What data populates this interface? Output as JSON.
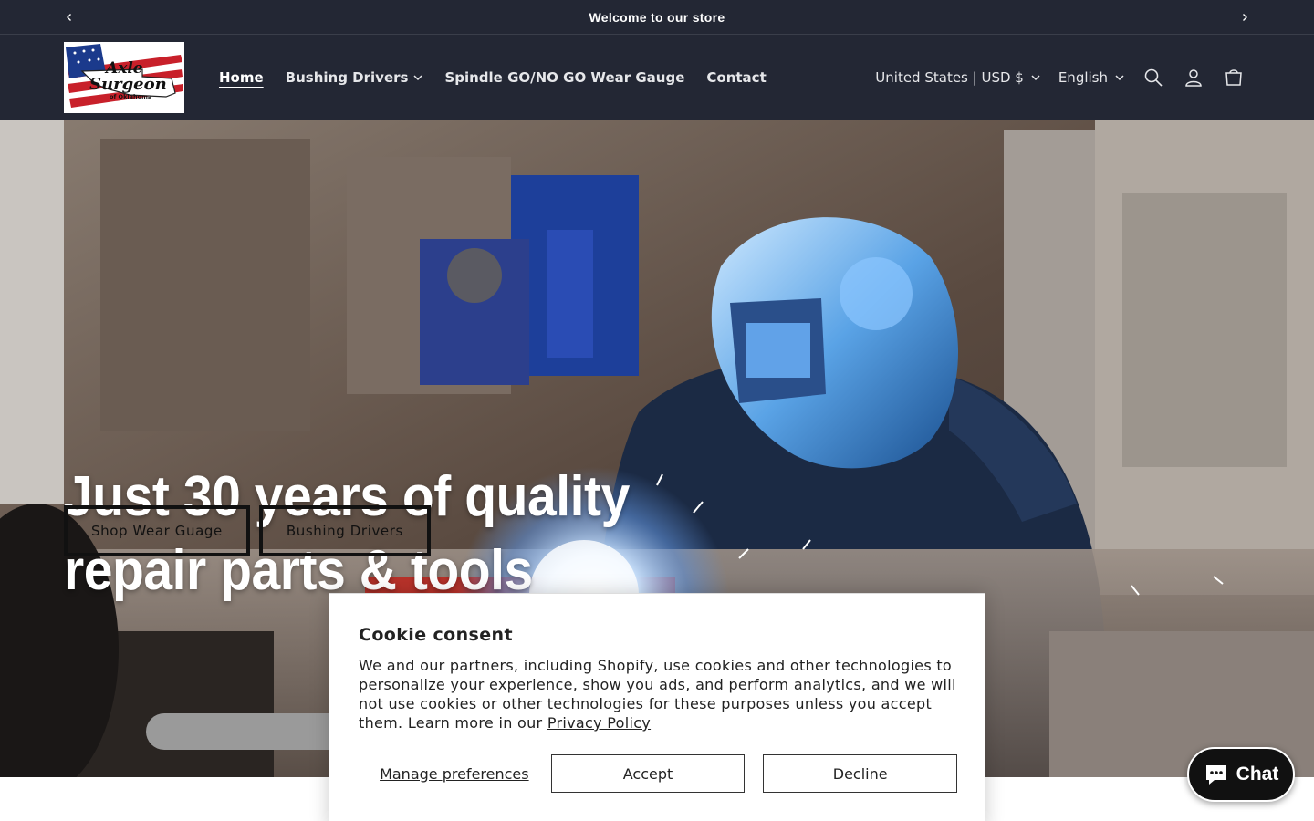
{
  "announcement": {
    "text": "Welcome to our store",
    "prev_icon": "chevron-left-icon",
    "next_icon": "chevron-right-icon"
  },
  "header": {
    "logo_lines": [
      "Axle",
      "Surgeon",
      "of Oklahoma"
    ],
    "nav": [
      {
        "label": "Home",
        "active": true
      },
      {
        "label": "Bushing Drivers",
        "dropdown": true
      },
      {
        "label": "Spindle GO/NO GO Wear Gauge"
      },
      {
        "label": "Contact"
      }
    ],
    "country_selector": "United States | USD $",
    "language_selector": "English",
    "icons": [
      "search-icon",
      "account-icon",
      "cart-icon"
    ]
  },
  "hero": {
    "title_line1": "Just 30 years of quality",
    "title_line2": "repair parts & tools",
    "buttons": [
      "Shop Wear Guage",
      "Bushing Drivers"
    ]
  },
  "cookie": {
    "title": "Cookie consent",
    "body": "We and our partners, including Shopify, use cookies and other technologies to personalize your experience, show you ads, and perform analytics, and we will not use cookies or other technologies for these purposes unless you accept them. Learn more in our ",
    "link": "Privacy Policy",
    "manage": "Manage preferences",
    "accept": "Accept",
    "decline": "Decline"
  },
  "chat": {
    "label": "Chat",
    "icon": "chat-bubble-icon"
  },
  "colors": {
    "header_bg": "#232734",
    "text_light": "#e6e7ea",
    "chat_bg": "#111111"
  }
}
